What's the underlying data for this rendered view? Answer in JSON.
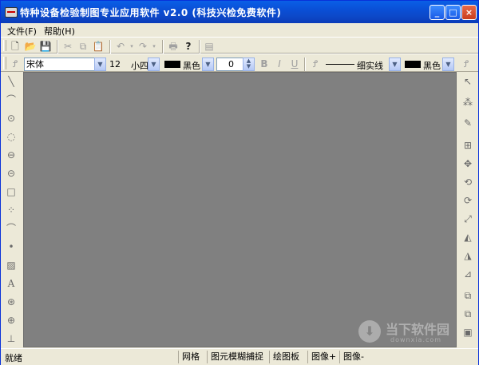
{
  "window": {
    "title": "特种设备检验制图专业应用软件 v2.0 (科技兴检免费软件)",
    "min_label": "_",
    "max_label": "□",
    "close_label": "×"
  },
  "menu": {
    "items": [
      {
        "label": "文件(F)"
      },
      {
        "label": "帮助(H)"
      }
    ]
  },
  "format_toolbar": {
    "font_name": "宋体",
    "font_size_value": "12",
    "font_size_name": "小四",
    "font_color": "黑色",
    "angle_value": "0",
    "bold": "B",
    "italic": "I",
    "underline": "U",
    "line_style": "细实线",
    "line_color": "黑色"
  },
  "status": {
    "ready": "就绪",
    "panels": [
      "网格",
      "图元模糊捕捉",
      "绘图板",
      "图像+",
      "图像-"
    ]
  },
  "watermark": {
    "text": "当下软件园",
    "url": "downxia.com"
  },
  "colors": {
    "title_bar": "#0a4fd6",
    "canvas": "#808080",
    "chrome": "#ece9d8"
  }
}
